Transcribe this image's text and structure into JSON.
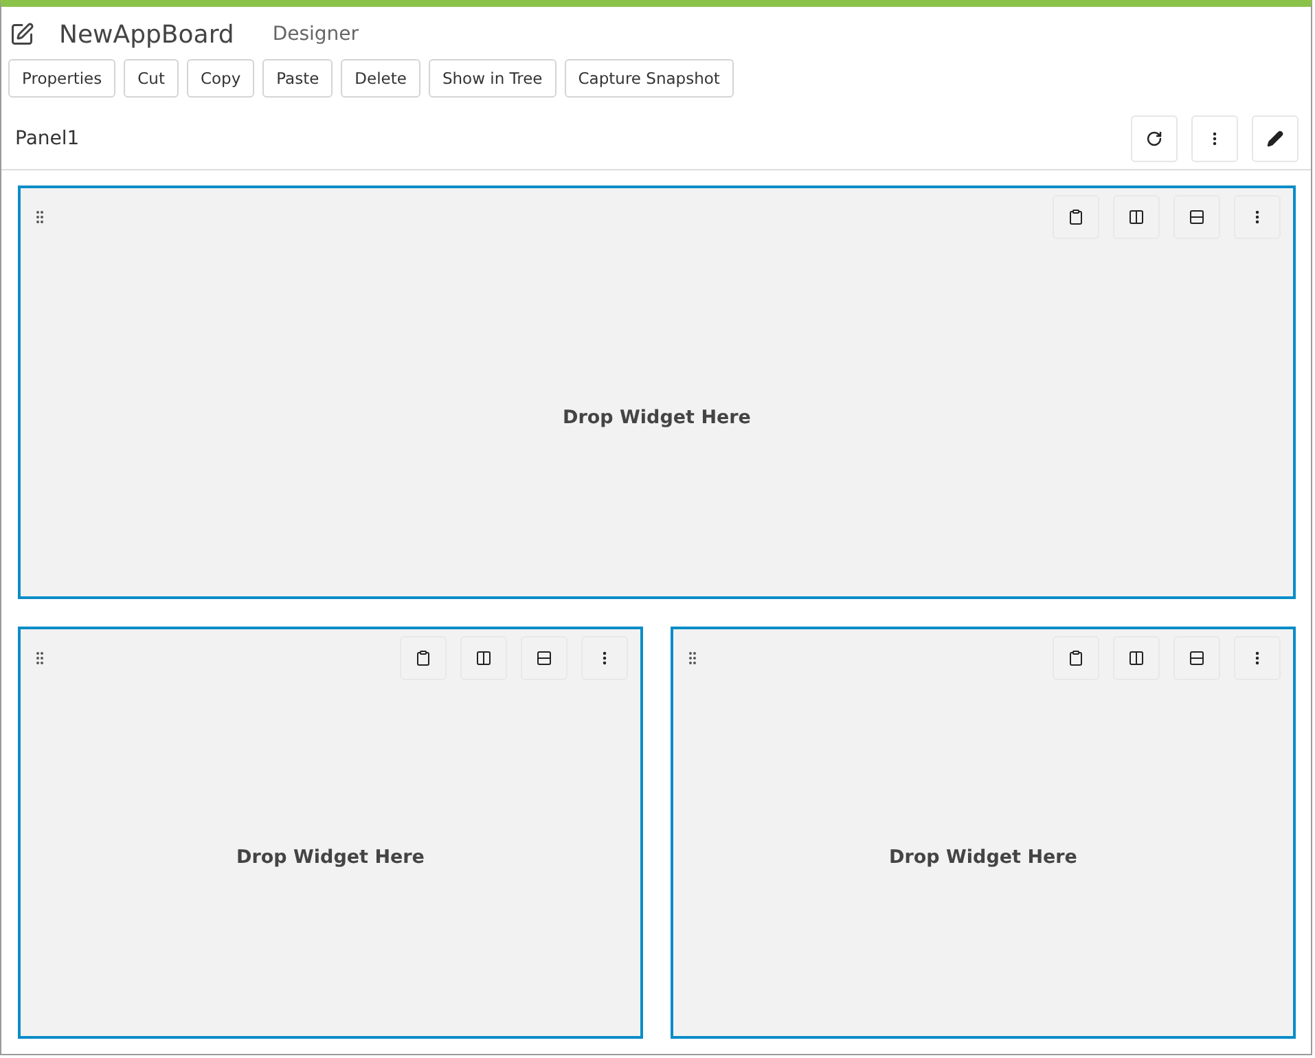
{
  "header": {
    "title": "NewAppBoard",
    "subtitle": "Designer"
  },
  "toolbar": [
    "Properties",
    "Cut",
    "Copy",
    "Paste",
    "Delete",
    "Show in Tree",
    "Capture Snapshot"
  ],
  "panel_title": "Panel1",
  "layout": [
    [
      {
        "placeholder": "Drop Widget Here"
      }
    ],
    [
      {
        "placeholder": "Drop Widget Here"
      },
      {
        "placeholder": "Drop Widget Here"
      }
    ]
  ]
}
